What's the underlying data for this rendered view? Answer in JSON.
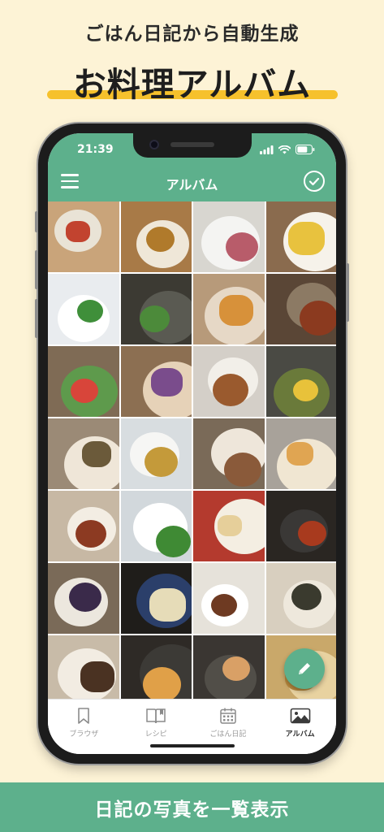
{
  "promo": {
    "subtitle": "ごはん日記から自動生成",
    "title": "お料理アルバム",
    "footer": "日記の写真を一覧表示"
  },
  "status_bar": {
    "time": "21:39"
  },
  "header": {
    "title": "アルバム",
    "menu_icon": "hamburger-menu-icon",
    "select_icon": "check-circle-icon"
  },
  "tabs": [
    {
      "label": "ブラウザ",
      "icon": "bookmark-icon",
      "active": false
    },
    {
      "label": "レシピ",
      "icon": "book-icon",
      "active": false
    },
    {
      "label": "ごはん日記",
      "icon": "calendar-icon",
      "active": false
    },
    {
      "label": "アルバム",
      "icon": "photo-icon",
      "active": true
    }
  ],
  "fab": {
    "icon": "pencil-icon"
  },
  "colors": {
    "accent_green": "#5db08c",
    "highlight_yellow": "#f6c12c",
    "background_cream": "#fdf3d6"
  },
  "photos": [
    {
      "bg": "#c9a47a",
      "dish": "#e9e3d6",
      "food": "#c2432f"
    },
    {
      "bg": "#a87a47",
      "dish": "#efe7d8",
      "food": "#b07a2b"
    },
    {
      "bg": "#d8d6d0",
      "dish": "#f4f4f2",
      "food": "#b85c6a"
    },
    {
      "bg": "#8a6b4e",
      "dish": "#f6f2ea",
      "food": "#e8c23e"
    },
    {
      "bg": "#e9ecef",
      "dish": "#ffffff",
      "food": "#3f8f3a"
    },
    {
      "bg": "#3c3a33",
      "dish": "#5a5a52",
      "food": "#4c8a3a"
    },
    {
      "bg": "#b79a7a",
      "dish": "#e6d8c6",
      "food": "#d7913a"
    },
    {
      "bg": "#5a4636",
      "dish": "#8c7a64",
      "food": "#8b3a1f"
    },
    {
      "bg": "#7f6b55",
      "dish": "#5e9a4c",
      "food": "#d8453a"
    },
    {
      "bg": "#8c6f52",
      "dish": "#e6d2b8",
      "food": "#7a4c8c"
    },
    {
      "bg": "#d4cfc8",
      "dish": "#f2efe9",
      "food": "#9a5a2e"
    },
    {
      "bg": "#4a4a44",
      "dish": "#6a7a3a",
      "food": "#e8c23a"
    },
    {
      "bg": "#9b8a76",
      "dish": "#efe6d8",
      "food": "#6b5a3a"
    },
    {
      "bg": "#d8dde0",
      "dish": "#f6f6f4",
      "food": "#c49a3a"
    },
    {
      "bg": "#7a6a58",
      "dish": "#eee6da",
      "food": "#8a5a3a"
    },
    {
      "bg": "#a8a29a",
      "dish": "#f0e6d2",
      "food": "#e0a552"
    },
    {
      "bg": "#c7b8a4",
      "dish": "#f3ede3",
      "food": "#8c3a22"
    },
    {
      "bg": "#d2d8dc",
      "dish": "#ffffff",
      "food": "#3f8a34"
    },
    {
      "bg": "#b43a2e",
      "dish": "#f4eee2",
      "food": "#e6cf9a"
    },
    {
      "bg": "#2a2622",
      "dish": "#3a3836",
      "food": "#a83a1e"
    },
    {
      "bg": "#7a6a58",
      "dish": "#ece7de",
      "food": "#3a2a4a"
    },
    {
      "bg": "#1f1d1a",
      "dish": "#2b3f6a",
      "food": "#e6dcb8"
    },
    {
      "bg": "#e6e2da",
      "dish": "#ffffff",
      "food": "#6e3a22"
    },
    {
      "bg": "#d8cfbf",
      "dish": "#eee8dc",
      "food": "#3a3a2e"
    },
    {
      "bg": "#c8bba8",
      "dish": "#f2ece2",
      "food": "#4a3222"
    },
    {
      "bg": "#2e2a26",
      "dish": "#3c3a36",
      "food": "#e0a048"
    },
    {
      "bg": "#3a3632",
      "dish": "#514e48",
      "food": "#d9a066"
    },
    {
      "bg": "#c9a86a",
      "dish": "#e8d2a0",
      "food": "#b98a3e"
    }
  ]
}
